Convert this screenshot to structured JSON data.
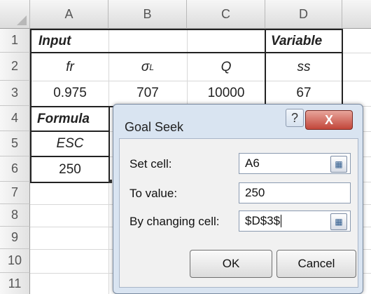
{
  "columns": [
    "A",
    "B",
    "C",
    "D"
  ],
  "rows": [
    "1",
    "2",
    "3",
    "4",
    "5",
    "6",
    "7",
    "8",
    "9",
    "10",
    "11"
  ],
  "cells": {
    "A1": "Input",
    "D1": "Variable",
    "A2": "fr",
    "B2": "σ",
    "B2_sub": "L",
    "C2": "Q",
    "D2": "ss",
    "A3": "0.975",
    "B3": "707",
    "C3": "10000",
    "D3": "67",
    "A4": "Formula",
    "A5": "ESC",
    "A6": "250"
  },
  "goal_seek": {
    "title": "Goal Seek",
    "help": "?",
    "close": "X",
    "set_cell_label": "Set cell:",
    "set_cell_value": "A6",
    "to_value_label": "To value:",
    "to_value_value": "250",
    "changing_cell_label": "By changing cell:",
    "changing_cell_value": "$D$3$",
    "ok_label": "OK",
    "cancel_label": "Cancel"
  },
  "colors": {
    "dialog_bg": "#d9e4f1",
    "close_btn": "#c2463a"
  },
  "icons": {
    "range_select": "range-select-icon",
    "close": "close-icon",
    "help": "help-icon"
  }
}
